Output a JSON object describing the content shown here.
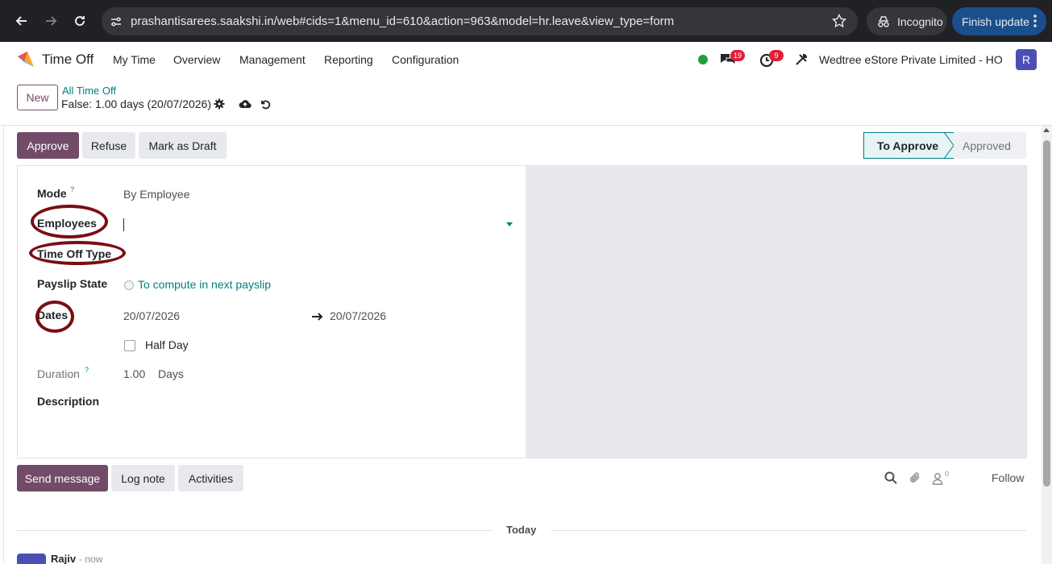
{
  "browser": {
    "url": "prashantisarees.saakshi.in/web#cids=1&menu_id=610&action=963&model=hr.leave&view_type=form",
    "incognito_label": "Incognito",
    "update_label": "Finish update"
  },
  "navbar": {
    "app_name": "Time Off",
    "menus": [
      "My Time",
      "Overview",
      "Management",
      "Reporting",
      "Configuration"
    ],
    "messages_count": "19",
    "activities_count": "9",
    "company": "Wedtree eStore Private Limited - HO",
    "avatar_initial": "R"
  },
  "control_panel": {
    "new_label": "New",
    "breadcrumb_parent": "All Time Off",
    "breadcrumb_current": "False: 1.00 days (20/07/2026)"
  },
  "statusbar": {
    "approve_label": "Approve",
    "refuse_label": "Refuse",
    "draft_label": "Mark as Draft",
    "stages": [
      "To Approve",
      "Approved"
    ],
    "active_stage": "To Approve"
  },
  "form": {
    "mode_label": "Mode",
    "mode_value": "By Employee",
    "employees_label": "Employees",
    "employees_value": "",
    "time_off_type_label": "Time Off Type",
    "payslip_label": "Payslip State",
    "payslip_value": "To compute in next payslip",
    "dates_label": "Dates",
    "date_from": "20/07/2026",
    "date_to": "20/07/2026",
    "half_day_label": "Half Day",
    "duration_label": "Duration",
    "duration_value": "1.00",
    "duration_unit": "Days",
    "description_label": "Description",
    "help_mark": "?"
  },
  "chatter": {
    "send_message_label": "Send message",
    "log_note_label": "Log note",
    "activities_label": "Activities",
    "followers_count": "0",
    "follow_label": "Follow",
    "date_separator": "Today",
    "author": "Rajiv",
    "time": "- now"
  },
  "colors": {
    "brand": "#714b67",
    "teal": "#017e84",
    "annotation": "#7a0d12"
  }
}
